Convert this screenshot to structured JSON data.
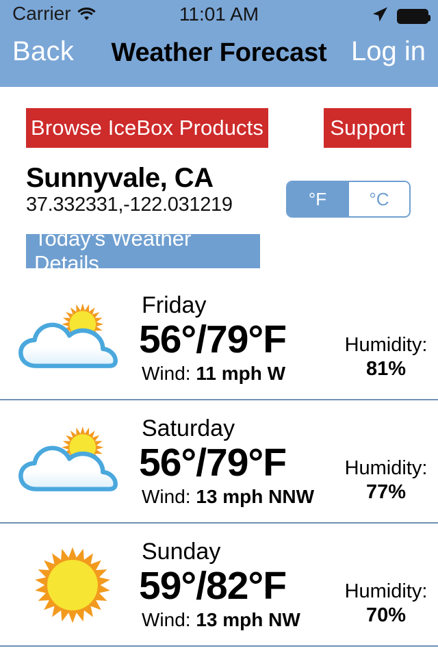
{
  "status_bar": {
    "carrier": "Carrier",
    "wifi_icon": "wifi-icon",
    "time": "11:01 AM",
    "location_icon": "location-arrow-icon",
    "battery_icon": "battery-full-icon"
  },
  "nav_bar": {
    "back_label": "Back",
    "title": "Weather Forecast",
    "login_label": "Log in"
  },
  "actions": {
    "browse_label": "Browse IceBox Products",
    "support_label": "Support",
    "button_color": "#ce2b2b"
  },
  "location": {
    "city": "Sunnyvale, CA",
    "coordinates": "37.332331,-122.031219"
  },
  "units": {
    "fahrenheit_label": "°F",
    "celsius_label": "°C",
    "selected": "°F",
    "accent_color": "#6f9fd0"
  },
  "details_banner": {
    "label": "Today's Weather Details",
    "color": "#6f9fd0"
  },
  "forecast": {
    "humidity_label": "Humidity:",
    "wind_label": "Wind:",
    "rows": [
      {
        "day": "Friday",
        "temp": "56°/79°F",
        "wind_value": "11 mph W",
        "humidity": "81%",
        "icon": "partly-cloudy-icon"
      },
      {
        "day": "Saturday",
        "temp": "56°/79°F",
        "wind_value": "13 mph NNW",
        "humidity": "77%",
        "icon": "partly-cloudy-icon"
      },
      {
        "day": "Sunday",
        "temp": "59°/82°F",
        "wind_value": "13 mph NW",
        "humidity": "70%",
        "icon": "sunny-icon"
      }
    ]
  }
}
